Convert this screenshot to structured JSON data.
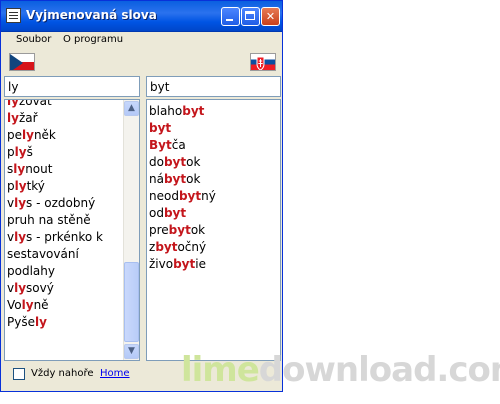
{
  "window": {
    "title": "Vyjmenovaná slova"
  },
  "menu": {
    "items": [
      "Soubor",
      "O programu"
    ]
  },
  "search": {
    "left_value": "ly",
    "right_value": "byt"
  },
  "left_list": [
    {
      "pre": "",
      "hl": "ly",
      "post": "zovat"
    },
    {
      "pre": "",
      "hl": "ly",
      "post": "žař"
    },
    {
      "pre": "pe",
      "hl": "ly",
      "post": "něk"
    },
    {
      "pre": "p",
      "hl": "ly",
      "post": "š"
    },
    {
      "pre": "s",
      "hl": "ly",
      "post": "nout"
    },
    {
      "pre": "p",
      "hl": "ly",
      "post": "tký"
    },
    {
      "pre": "v",
      "hl": "ly",
      "post": "s - ozdobný"
    },
    {
      "pre": "pruh na stěně",
      "hl": "",
      "post": ""
    },
    {
      "pre": "v",
      "hl": "ly",
      "post": "s - prkénko k"
    },
    {
      "pre": "sestavování",
      "hl": "",
      "post": ""
    },
    {
      "pre": "podlahy",
      "hl": "",
      "post": ""
    },
    {
      "pre": "v",
      "hl": "ly",
      "post": "sový"
    },
    {
      "pre": "Vo",
      "hl": "ly",
      "post": "ně"
    },
    {
      "pre": "Pyše",
      "hl": "ly",
      "post": ""
    }
  ],
  "right_list": [
    {
      "pre": "blaho",
      "hl": "byt",
      "post": ""
    },
    {
      "pre": "",
      "hl": "byt",
      "post": ""
    },
    {
      "pre": "",
      "hl": "Byt",
      "post": "ča"
    },
    {
      "pre": "do",
      "hl": "byt",
      "post": "ok"
    },
    {
      "pre": "ná",
      "hl": "byt",
      "post": "ok"
    },
    {
      "pre": "neod",
      "hl": "byt",
      "post": "ný"
    },
    {
      "pre": "od",
      "hl": "byt",
      "post": ""
    },
    {
      "pre": "pre",
      "hl": "byt",
      "post": "ok"
    },
    {
      "pre": "z",
      "hl": "byt",
      "post": "očný"
    },
    {
      "pre": "živo",
      "hl": "byt",
      "post": "ie"
    }
  ],
  "bottom": {
    "always_on_top_label": "Vždy nahoře",
    "home_label": "Home"
  },
  "watermark": {
    "part1": "lime",
    "part2": "download.com"
  },
  "colors": {
    "highlight": "#c4161c",
    "titlebar": "#0054e3"
  },
  "icons": [
    "app-icon",
    "minimize-icon",
    "maximize-icon",
    "close-icon",
    "czech-flag-icon",
    "slovak-flag-icon",
    "scroll-up-icon",
    "scroll-down-icon"
  ]
}
